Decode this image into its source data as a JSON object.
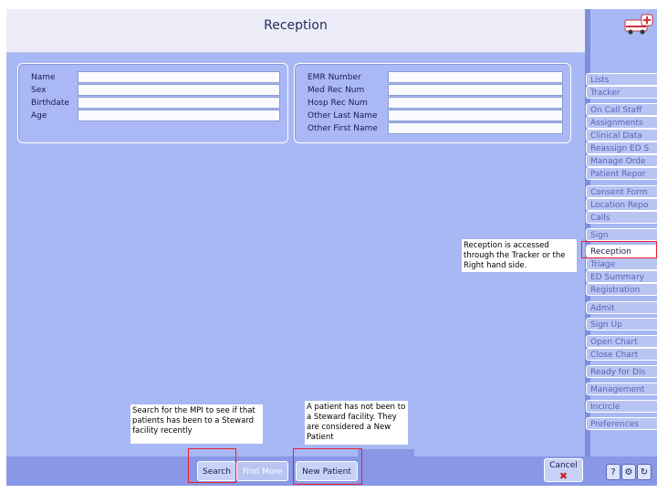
{
  "header": {
    "title": "Reception"
  },
  "left_form": {
    "fields": [
      {
        "label": "Name",
        "value": ""
      },
      {
        "label": "Sex",
        "value": ""
      },
      {
        "label": "Birthdate",
        "value": ""
      },
      {
        "label": "Age",
        "value": ""
      }
    ]
  },
  "right_form": {
    "fields": [
      {
        "label": "EMR Number",
        "value": ""
      },
      {
        "label": "Med Rec Num",
        "value": ""
      },
      {
        "label": "Hosp Rec Num",
        "value": ""
      },
      {
        "label": "Other Last Name",
        "value": ""
      },
      {
        "label": "Other First Name",
        "value": ""
      }
    ]
  },
  "sidebar": {
    "items": [
      {
        "label": "Lists"
      },
      {
        "label": "Tracker"
      },
      {
        "label": "On Call Staff"
      },
      {
        "label": "Assignments"
      },
      {
        "label": "Clinical Data"
      },
      {
        "label": "Reassign ED S"
      },
      {
        "label": "Manage Orde"
      },
      {
        "label": "Patient Repor"
      },
      {
        "label": "Consent Form"
      },
      {
        "label": "Location Repo"
      },
      {
        "label": "Calls"
      },
      {
        "label": "Sign"
      },
      {
        "label": "Reception"
      },
      {
        "label": "Triage"
      },
      {
        "label": "ED Summary"
      },
      {
        "label": "Registration"
      },
      {
        "label": "Admit"
      },
      {
        "label": "Sign Up"
      },
      {
        "label": "Open Chart"
      },
      {
        "label": "Close Chart"
      },
      {
        "label": "Ready for Dis"
      },
      {
        "label": "Management"
      },
      {
        "label": "Incircle"
      },
      {
        "label": "Preferences"
      }
    ]
  },
  "notes": {
    "reception_note": "Reception is accessed through the Tracker or the Right hand side.",
    "search_note": "Search for the MPI to see if that patients has been to a Steward facility recently",
    "new_patient_note": "A patient has not been to a Steward facility. They are considered a New Patient"
  },
  "toolbar": {
    "search_label": "Search",
    "find_more_label": "Find More",
    "new_patient_label": "New Patient",
    "cancel_label": "Cancel",
    "cancel_mark": "✖",
    "help_label": "?"
  },
  "colors": {
    "accent": "#a8b8f4",
    "highlight": "#e8202c"
  },
  "icons": {
    "logo": "ambulance-icon"
  }
}
